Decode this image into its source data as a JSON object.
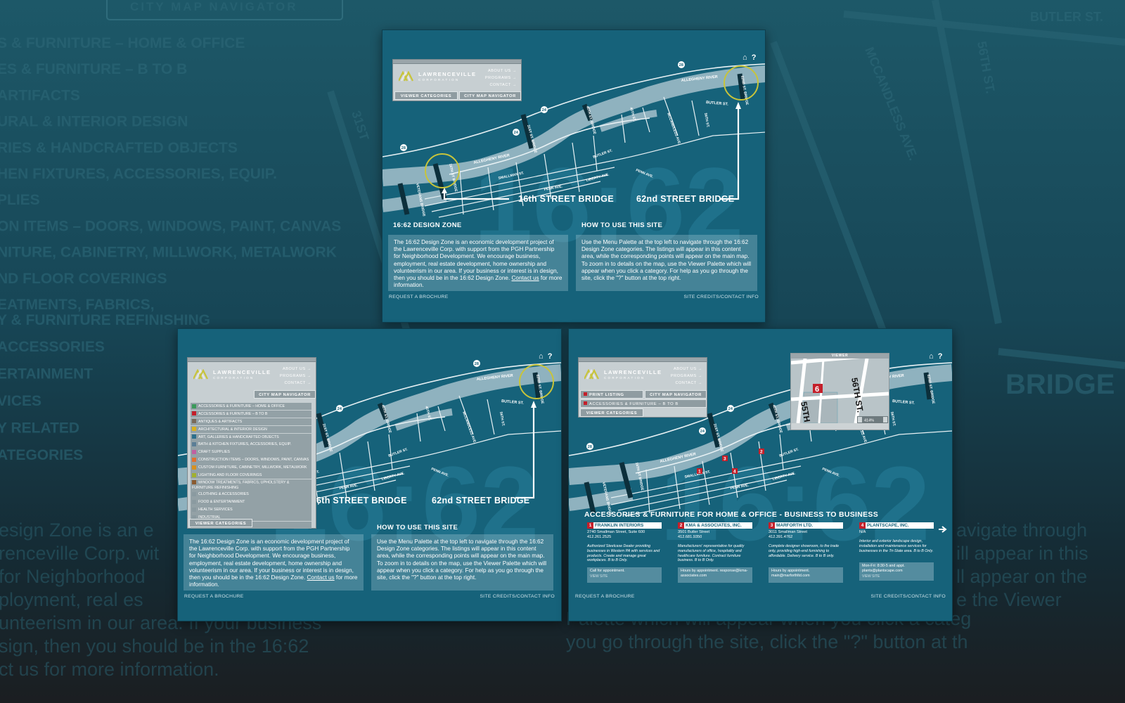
{
  "background": {
    "header_label": "CITY MAP NAVIGATOR",
    "category_lines": [
      "S & FURNITURE – HOME & OFFICE",
      "ES & FURNITURE – B TO B",
      "ARTIFACTS",
      "URAL & INTERIOR DESIGN",
      "RIES & HANDCRAFTED OBJECTS",
      "HEN FIXTURES, ACCESSORIES, EQUIP.",
      "PLIES",
      "ON ITEMS – DOORS, WINDOWS, PAINT, CANVAS",
      "NITURE, CABINETRY, MILLWORK, METALWORK",
      "ND FLOOR COVERINGS",
      "EATMENTS, FABRICS,",
      "Y & FURNITURE REFINISHING",
      "ACCESSORIES",
      "ERTAINMENT",
      "VICES",
      "Y RELATED",
      "ATEGORIES"
    ],
    "body_left": [
      "esign Zone is an e",
      "renceville Corp. wit",
      "for Neighborhood",
      "ployment, real es",
      "unteerism in our area. If your business",
      "sign, then you should be in the 16:62",
      "ct us for more information."
    ],
    "body_right": [
      "avigate through",
      "ill appear in this",
      "ll appear on the",
      "e the Viewer",
      "Palette which will appear when you click a categ",
      "you go through the site, click the \"?\" button at th"
    ],
    "street_labels": [
      "BUTLER ST.",
      "MCCANDLESS AVE.",
      "56TH ST.",
      "31ST",
      "BRIDGE"
    ]
  },
  "site": {
    "logo_name": "LAWRENCEVILLE",
    "logo_sub": "CORPORATION",
    "menu": [
      "ABOUT US →",
      "PROGRAMS →",
      "CONTACT →"
    ],
    "btn_viewer_categories": "VIEWER CATEGORIES",
    "btn_city_map_navigator": "CITY MAP NAVIGATOR",
    "home_icon": "home-icon",
    "help_label": "?",
    "footer_left": "REQUEST A BROCHURE",
    "footer_right": "SITE CREDITS/CONTACT INFO",
    "bridge_left": "16th STREET BRIDGE",
    "bridge_left_cropped": "6th STREET BRIDGE",
    "bridge_right": "62nd STREET BRIDGE",
    "design_zone_title": "16:62 DESIGN ZONE",
    "design_zone_pre": "The 16:62 Design Zone is an economic development project of the Lawrenceville Corp. with support from the PGH Partnership for Neighborhood Development. We encourage business, employment, real estate development, home ownership and volunteerism in our area. If your business or interest is in design, then you should be in the 16:62 Design Zone.",
    "contact_link": "Contact us",
    "design_zone_post": " for more information.",
    "how_title": "HOW TO USE THIS SITE",
    "how_text": "Use the Menu Palette at the top left to navigate through the 16:62 Design Zone categories. The listings will appear in this content area, while the corresponding points will appear on the main map. To zoom in to details on the map, use the Viewer Palette which will appear when you click a category. For help as you go through the site, click the \"?\" button at the top right."
  },
  "map_labels": {
    "river": "ALLEGHENY RIVER",
    "butler": "BUTLER ST.",
    "streets": [
      "VETERANS BRIDGE",
      "16TH ST BRIDGE",
      "31ST ST. BRIDGE",
      "40TH ST. BRIDGE",
      "62ND ST. BRIDGE",
      "SMALLMAN ST.",
      "PENN AVE.",
      "LIBERTY AVE.",
      "BUTLER ST.",
      "40TH ST.",
      "MCCANDLESS AVE.",
      "56TH ST.",
      "16TH ST.",
      "34TH ST."
    ],
    "route_28": "28",
    "route_24": "24",
    "watermark": "16:62"
  },
  "categories": [
    {
      "label": "ACCESSORIES & FURNITURE – HOME & OFFICE",
      "color": "#3b9a5a"
    },
    {
      "label": "ACCESSORIES & FURNITURE – B TO B",
      "color": "#c41f2a"
    },
    {
      "label": "ANTIQUES & ARTIFACTS",
      "color": "#7a6a5a"
    },
    {
      "label": "ARCHITECTURAL & INTERIOR DESIGN",
      "color": "#d8b020"
    },
    {
      "label": "ART, GALLERIES & HANDCRAFTED OBJECTS",
      "color": "#2a6e8c"
    },
    {
      "label": "BATH & KITCHEN FIXTURES, ACCESSORIES, EQUIP.",
      "color": "#5a7e96"
    },
    {
      "label": "CRAFT SUPPLIES",
      "color": "#c060a0"
    },
    {
      "label": "CONSTRUCTION ITEMS – DOORS, WINDOWS, PAINT, CANVAS",
      "color": "#e07030"
    },
    {
      "label": "CUSTOM FURNITURE, CABINETRY, MILLWORK, METALWORK",
      "color": "#d89020"
    },
    {
      "label": "LIGHTING AND FLOOR COVERINGS",
      "color": "#a0b030"
    },
    {
      "label": "WINDOW TREATMENTS, FABRICS, UPHOLSTERY & FURNITURE REFINISHING",
      "color": "#8a5a30"
    },
    {
      "label": "CLOTHING & ACCESSORIES",
      "color": "#8a9aa0"
    },
    {
      "label": "FOOD & ENTERTAINMENT",
      "color": "#8a9aa0"
    },
    {
      "label": "HEALTH SERVICES",
      "color": "#8a9aa0"
    },
    {
      "label": "INDUSTRIAL",
      "color": "#8a9aa0"
    },
    {
      "label": "TECHNOLOGY RELATED",
      "color": "#8a9aa0"
    }
  ],
  "panel3": {
    "print_listing": "PRINT LISTING",
    "selected_category": "ACCESSORIES & FURNITURE – B TO B",
    "viewer_title": "VIEWER",
    "viewer_zoom": "414%",
    "viewer_marker": "6",
    "viewer_street_a": "56TH ST.",
    "viewer_street_b": "55TH S",
    "heading": "ACCESSORIES & FURNITURE FOR HOME & OFFICE - BUSINESS TO BUSINESS",
    "markers": [
      "1",
      "2",
      "3",
      "4"
    ],
    "listings": [
      {
        "num": "1",
        "name": "FRANKLIN INTERIORS",
        "addr": "2740 Smallman Street, Suite 600",
        "phone": "412.261.2525",
        "desc": "Authorized Steelcase Dealer providing businesses in Western PA with services and products. Create and manage great workplaces. B to B Only.",
        "hours": "Call for appointment.",
        "site": "VIEW SITE"
      },
      {
        "num": "2",
        "name": "KMA & ASSOCIATES, INC.",
        "addr": "3501 Butler Street",
        "phone": "412.681.9350",
        "desc": "Manufacturers' representative for quality manufacturers of office, hospitality and healthcare furniture. Contract furniture business. B to B Only.",
        "hours": "Hours by appointment. response@kma-associates.com",
        "site": ""
      },
      {
        "num": "3",
        "name": "MARFORTH LTD.",
        "addr": "3011 Smallman Street",
        "phone": "412.391.4762",
        "desc": "Complete designer showroom, to the trade only, providing high-end furnishing to affordable. Delivery service. B to B only.",
        "hours": "Hours by appointment. main@marforthltd.com",
        "site": ""
      },
      {
        "num": "4",
        "name": "PLANTSCAPE, INC.",
        "addr": "N/A",
        "phone": "",
        "desc": "Interior and exterior landscape design, installation and maintenance services for businesses in the Tri-State area. B to B Only.",
        "hours": "Mon-Fri: 8:30-5 and appt. plants@plantscape.com",
        "site": "VIEW SITE"
      }
    ]
  },
  "colors": {
    "panel_bg": "#16627a",
    "river": "#8fb2bf",
    "highlight_circle": "#c8c43a",
    "marker_red": "#c41f2a"
  }
}
